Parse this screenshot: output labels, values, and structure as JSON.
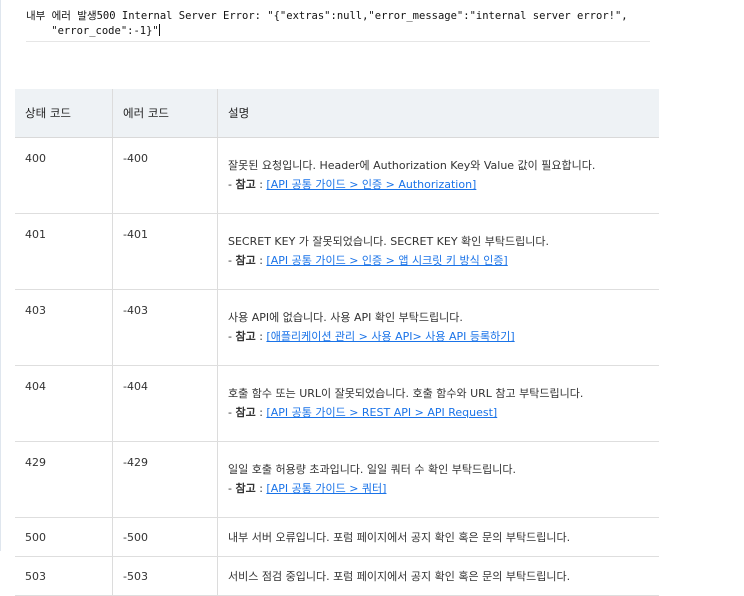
{
  "error_banner": {
    "line1": "내부 에러 발생500 Internal Server Error: \"{\"extras\":null,\"error_message\":\"internal server error!\",",
    "line2": "    \"error_code\":-1}\""
  },
  "table": {
    "headers": [
      "상태 코드",
      "에러 코드",
      "설명"
    ],
    "ref_prefix": "- ",
    "ref_label": "참고",
    "ref_sep": " : ",
    "rows": [
      {
        "status": "400",
        "code": "-400",
        "desc": "잘못된 요청입니다. Header에 Authorization Key와 Value 값이 필요합니다.",
        "link": "[API 공통 가이드 > 인증 > Authorization]"
      },
      {
        "status": "401",
        "code": "-401",
        "desc": "SECRET KEY 가 잘못되었습니다. SECRET KEY 확인 부탁드립니다.",
        "link": "[API 공통 가이드 > 인증 > 앱 시크릿 키 방식 인증]"
      },
      {
        "status": "403",
        "code": "-403",
        "desc": "사용 API에 없습니다. 사용 API 확인 부탁드립니다.",
        "link": "[애플리케이션 관리 > 사용 API> 사용 API 등록하기]"
      },
      {
        "status": "404",
        "code": "-404",
        "desc": "호출 함수 또는 URL이 잘못되었습니다. 호출 함수와 URL 참고 부탁드립니다.",
        "link": "[API 공통 가이드 > REST API > API Request]"
      },
      {
        "status": "429",
        "code": "-429",
        "desc": "일일 호출 허용량 초과입니다. 일일 쿼터 수 확인 부탁드립니다.",
        "link": "[API 공통 가이드 > 쿼터]"
      },
      {
        "status": "500",
        "code": "-500",
        "desc": "내부 서버 오류입니다. 포럼 페이지에서 공지 확인 혹은 문의 부탁드립니다."
      },
      {
        "status": "503",
        "code": "-503",
        "desc": "서비스 점검 중입니다. 포럼 페이지에서 공지 확인 혹은 문의 부탁드립니다."
      }
    ]
  }
}
